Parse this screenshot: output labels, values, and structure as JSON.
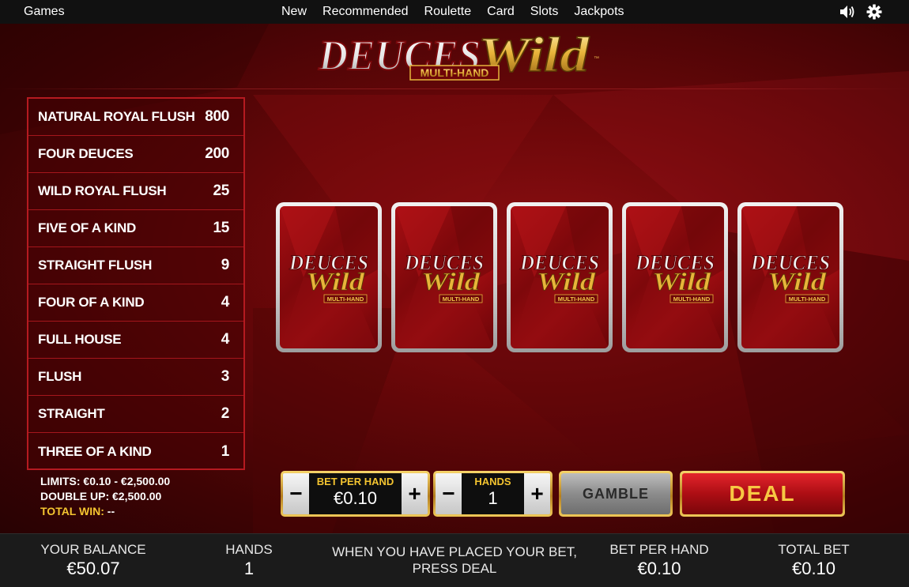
{
  "nav": {
    "games": "Games",
    "items": [
      "New",
      "Recommended",
      "Roulette",
      "Card",
      "Slots",
      "Jackpots"
    ]
  },
  "logo": {
    "title_1": "DEUCES",
    "title_2": "Wild",
    "subtitle": "MULTI-HAND",
    "tm": "™"
  },
  "card_back": {
    "title_1": "DEUCES",
    "title_2": "Wild",
    "subtitle": "MULTI-HAND"
  },
  "paytable": [
    {
      "hand": "NATURAL ROYAL FLUSH",
      "pay": "800"
    },
    {
      "hand": "FOUR DEUCES",
      "pay": "200"
    },
    {
      "hand": "WILD ROYAL FLUSH",
      "pay": "25"
    },
    {
      "hand": "FIVE OF A KIND",
      "pay": "15"
    },
    {
      "hand": "STRAIGHT FLUSH",
      "pay": "9"
    },
    {
      "hand": "FOUR OF A KIND",
      "pay": "4"
    },
    {
      "hand": "FULL HOUSE",
      "pay": "4"
    },
    {
      "hand": "FLUSH",
      "pay": "3"
    },
    {
      "hand": "STRAIGHT",
      "pay": "2"
    },
    {
      "hand": "THREE OF A KIND",
      "pay": "1"
    }
  ],
  "limits": {
    "limits": "LIMITS: €0.10 - €2,500.00",
    "double_up": "DOUBLE UP: €2,500.00",
    "total_win_label": "TOTAL WIN:",
    "total_win_value": "--"
  },
  "controls": {
    "bet_per_hand": {
      "label": "BET PER HAND",
      "value": "€0.10",
      "minus": "−",
      "plus": "+"
    },
    "hands": {
      "label": "HANDS",
      "value": "1",
      "minus": "−",
      "plus": "+"
    },
    "gamble": "GAMBLE",
    "deal": "DEAL"
  },
  "bottom": {
    "balance_label": "YOUR BALANCE",
    "balance_value": "€50.07",
    "hands_label": "HANDS",
    "hands_value": "1",
    "message_1": "WHEN YOU HAVE PLACED YOUR BET,",
    "message_2": "PRESS DEAL",
    "bet_label": "BET PER HAND",
    "bet_value": "€0.10",
    "total_label": "TOTAL BET",
    "total_value": "€0.10"
  },
  "icons": {
    "sound": "speaker-icon",
    "settings": "gear-icon"
  },
  "colors": {
    "accent_gold": "#f4c430",
    "paytable_border": "#b51a20",
    "deal_red": "#c4151b"
  }
}
